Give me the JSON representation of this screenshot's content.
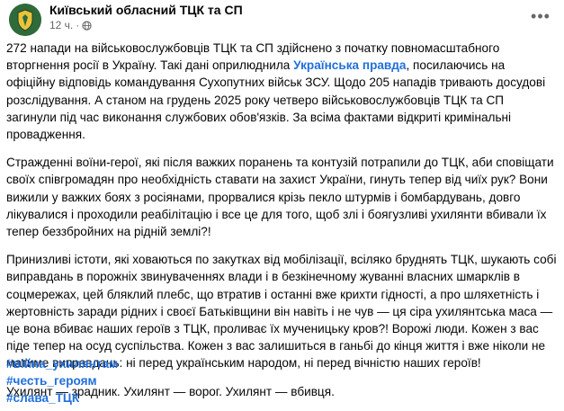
{
  "header": {
    "page_name": "Київський обласний ТЦК та СП",
    "time": "12 ч.",
    "separator": "·",
    "more_label": "•••"
  },
  "post": {
    "p1_text_before": "272 напади на військовослужбовців ТЦК та СП здійснено з початку повномасштабного вторгнення росії в Україну. Такі дані оприлюднила ",
    "p1_link": "Українська правда",
    "p1_text_after": ", посилаючись на офіційну відповідь командування Сухопутних військ ЗСУ. Щодо 205 нападів тривають досудові розслідування. А станом на грудень 2025 року четверо військовослужбовців ТЦК та СП загинули під час виконання службових обов'язків. За всіма фактами відкриті кримінальні провадження.",
    "p2": "Стражденні воїни-герої, які після важких поранень та контузій потрапили до ТЦК, аби сповіщати своїх співгромадян про необхідність ставати на захист України, гинуть тепер від чиїх рук? Вони вижили у важких боях з росіянами, прорвалися крізь пекло штурмів і бомбардувань, довго лікувалися і проходили реабілітацію і все це для того, щоб злі і боягузливі ухилянти вбивали їх тепер беззбройних на рідній землі?!",
    "p3": "Принизливі істоти, які ховаються по закутках від мобілізації, всіляко бруднять ТЦК, шукають собі виправдань в порожніх звинуваченнях влади і в безкінечному жуванні власних шмарклів в соцмережах, цей бляклий плебс, що втратив і останні вже крихти гідності, а про шляхетність і жертовність заради рідних і своєї Батьківщини він навіть і не чув — ця сіра ухилянтська маса — це вона вбиває наших героїв з ТЦК, проливає їх мученицьку кров?! Ворожі люди. Кожен з вас піде тепер на осуд суспільства. Кожен з вас залишиться в ганьбі до кінця життя і вже ніколи не матиме виправдань: ні перед українським народом, ні перед вічністю наших героїв!",
    "p4": "Ухилянт — зрадник. Ухилянт — ворог. Ухилянт — вбивця.",
    "hashtags": [
      "#війна_ухилянтам",
      "#честь_героям",
      "#слава_ТЦК"
    ]
  },
  "colors": {
    "link": "#216fdb",
    "meta_text": "#65676b",
    "avatar_bg": "#2f6a3a"
  },
  "icons": [
    "page-avatar",
    "globe-icon",
    "more-options-icon"
  ]
}
